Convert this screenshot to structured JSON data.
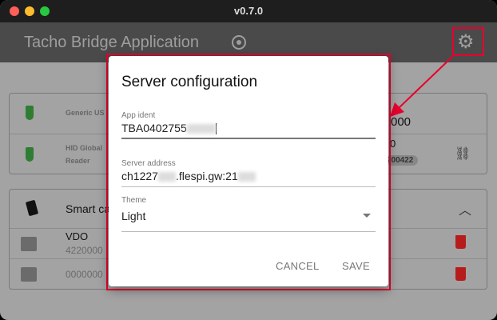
{
  "window": {
    "version": "v0.7.0"
  },
  "header": {
    "title": "Tacho Bridge Application",
    "status_icon": "radio-target-icon",
    "settings_icon": "gear-icon"
  },
  "readers": [
    {
      "name": "Generic US",
      "value": "000",
      "icon": "usb-icon"
    },
    {
      "name_line1": "HID Global",
      "name_line2": "Reader",
      "value": "0",
      "badge": "200422",
      "icon": "usb-icon",
      "action_icon": "link-icon"
    }
  ],
  "cards": {
    "title": "Smart ca",
    "items": [
      {
        "name": "VDO",
        "number": "4220000"
      },
      {
        "name": "",
        "number": "0000000"
      }
    ]
  },
  "dialog": {
    "title": "Server configuration",
    "app_ident_label": "App ident",
    "app_ident_value": "TBA0402755",
    "server_label": "Server address",
    "server_value_a": "ch1227",
    "server_value_b": ".flespi.gw:21",
    "theme_label": "Theme",
    "theme_value": "Light",
    "cancel": "CANCEL",
    "save": "SAVE"
  },
  "colors": {
    "highlight": "#e8002d",
    "usb": "#2e7d32",
    "delete": "#b71c1c"
  }
}
